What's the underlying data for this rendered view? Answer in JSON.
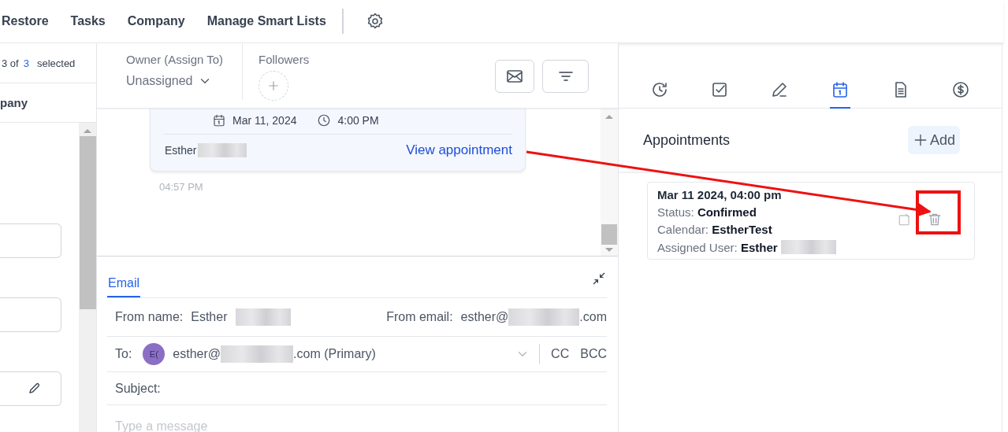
{
  "nav": {
    "items": [
      "Restore",
      "Tasks",
      "Company",
      "Manage Smart Lists"
    ]
  },
  "left_panel": {
    "selection": {
      "count": "3 of",
      "total": "3",
      "suffix": "selected"
    },
    "column_header": "pany",
    "fields": [
      {
        "kind": "input"
      },
      {
        "kind": "input"
      },
      {
        "kind": "edit"
      }
    ]
  },
  "contact_header": {
    "owner_label": "Owner (Assign To)",
    "owner_value": "Unassigned",
    "followers_label": "Followers"
  },
  "appointment_message": {
    "date": "Mar 11, 2024",
    "time": "4:00 PM",
    "sender": "Esther",
    "link": "View appointment",
    "timestamp": "04:57 PM"
  },
  "composer": {
    "tabs": [
      {
        "label": "Email",
        "selected": true
      }
    ],
    "from_name_label": "From name:",
    "from_name": "Esther",
    "from_email_label": "From email:",
    "from_email_prefix": "esther@",
    "from_email_suffix": ".com",
    "to_label": "To:",
    "to_avatar": "E(",
    "to_prefix": "esther@",
    "to_suffix": ".com (Primary)",
    "cc": "CC",
    "bcc": "BCC",
    "subject_label": "Subject:",
    "placeholder": "Type a message"
  },
  "right_panel": {
    "tabs": [
      {
        "kind": "history",
        "selected": false
      },
      {
        "kind": "task",
        "selected": false
      },
      {
        "kind": "note",
        "selected": false
      },
      {
        "kind": "calendar",
        "selected": true
      },
      {
        "kind": "document",
        "selected": false
      },
      {
        "kind": "payment",
        "selected": false
      }
    ],
    "title": "Appointments",
    "add": "Add",
    "appointments": [
      {
        "datetime": "Mar 11 2024, 04:00 pm",
        "status_label": "Status:",
        "status": "Confirmed",
        "calendar_label": "Calendar:",
        "calendar": "EstherTest",
        "user_label": "Assigned User:",
        "user": "Esther"
      }
    ]
  }
}
